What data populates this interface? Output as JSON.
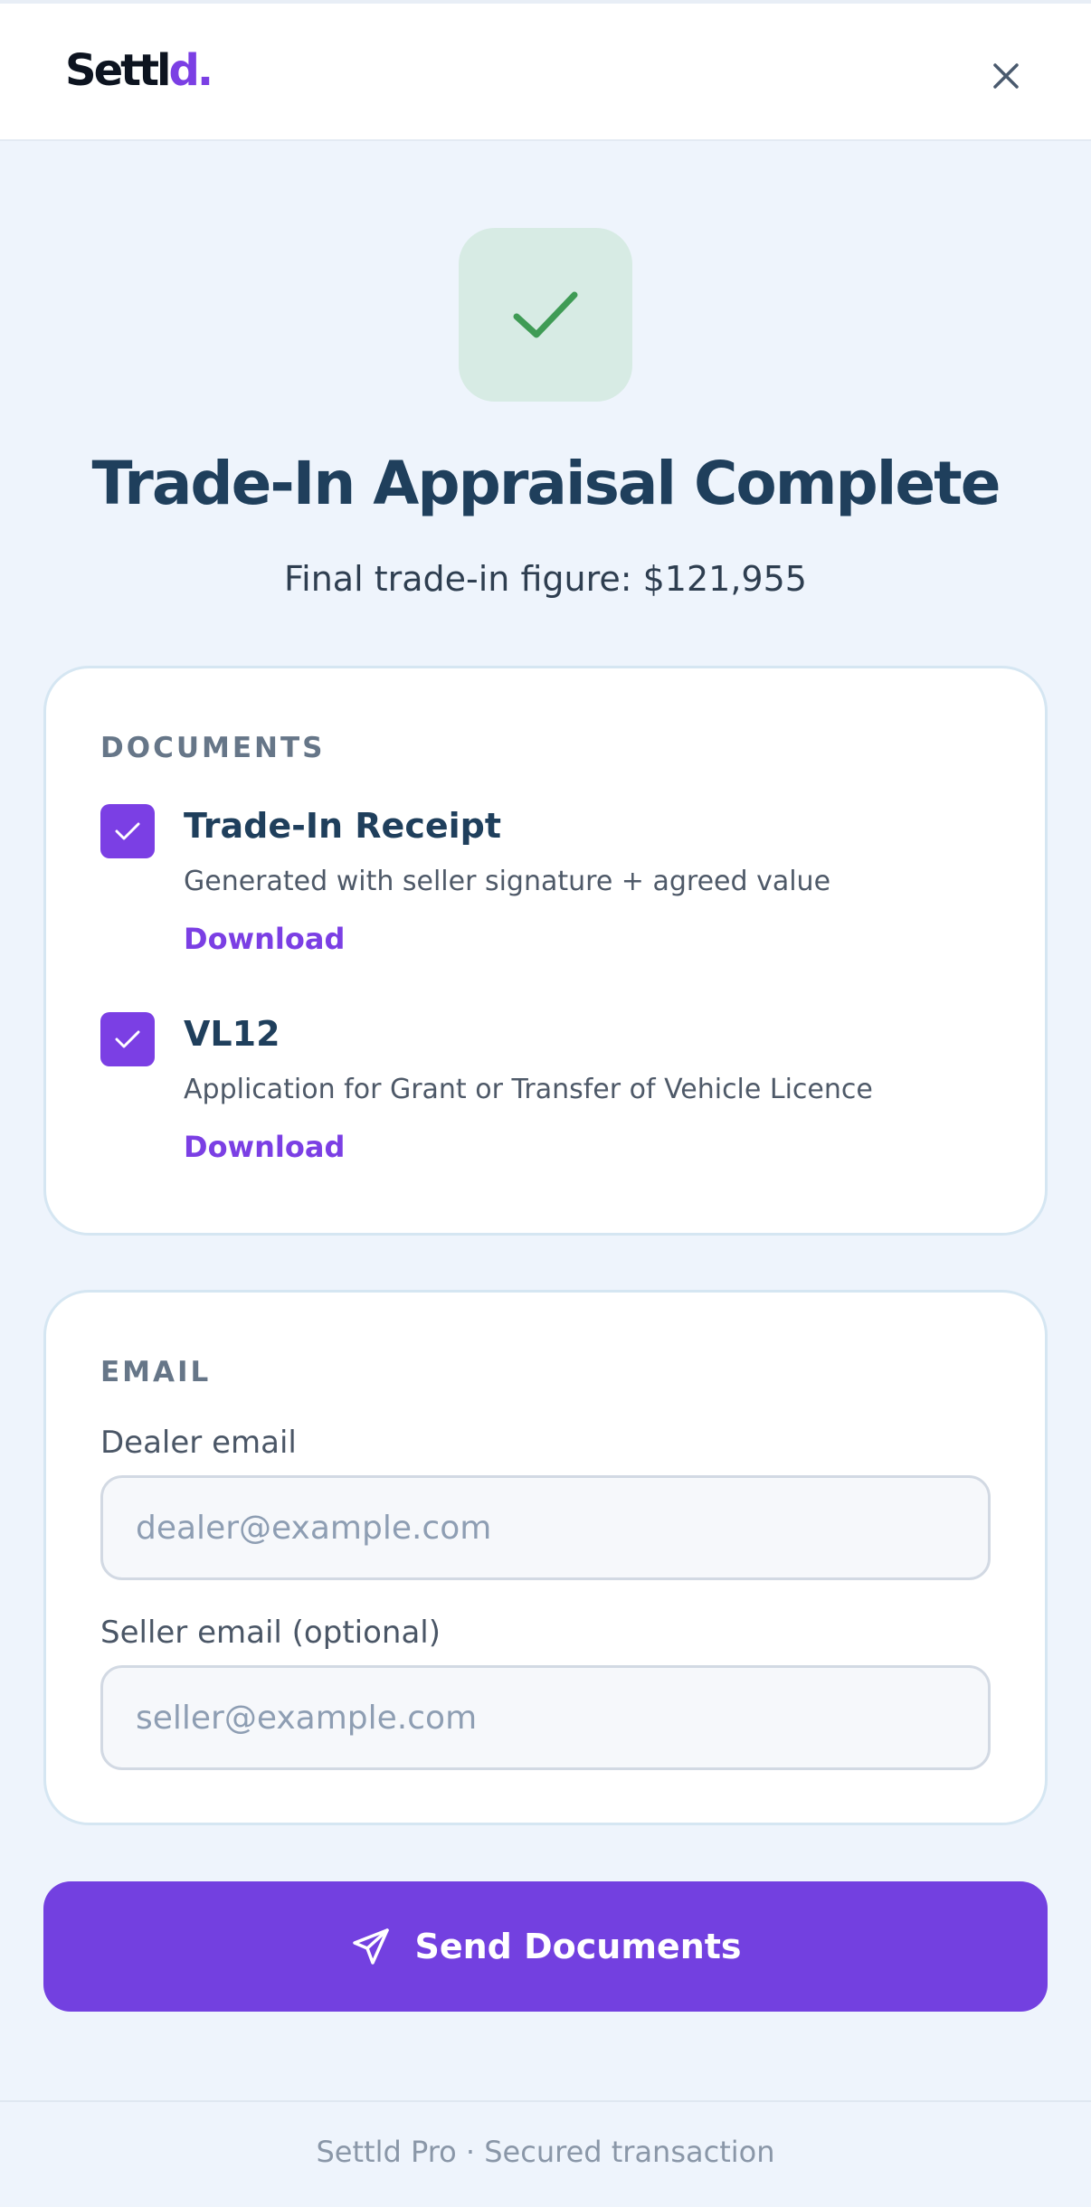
{
  "header": {
    "logo_main": "Settl",
    "logo_accent": "d.",
    "close_icon": "close-icon"
  },
  "hero": {
    "icon": "check-icon",
    "title": "Trade-In Appraisal Complete",
    "subtitle": "Final trade-in figure: $121,955"
  },
  "documents": {
    "label": "DOCUMENTS",
    "items": [
      {
        "title": "Trade-In Receipt",
        "description": "Generated with seller signature + agreed value",
        "action": "Download",
        "checked": true
      },
      {
        "title": "VL12",
        "description": "Application for Grant or Transfer of Vehicle Licence",
        "action": "Download",
        "checked": true
      }
    ]
  },
  "email": {
    "label": "EMAIL",
    "dealer": {
      "label": "Dealer email",
      "placeholder": "dealer@example.com",
      "value": ""
    },
    "seller": {
      "label": "Seller email (optional)",
      "placeholder": "seller@example.com",
      "value": ""
    }
  },
  "send_button": {
    "label": "Send Documents",
    "icon": "send-icon"
  },
  "footer": {
    "text": "Settld Pro · Secured transaction"
  },
  "colors": {
    "accent": "#7b3fe4",
    "button": "#7340e0",
    "success_bg": "#d7ebe4",
    "success_check": "#3f9b55",
    "background": "#eef4fc",
    "title": "#1f3f5c"
  }
}
